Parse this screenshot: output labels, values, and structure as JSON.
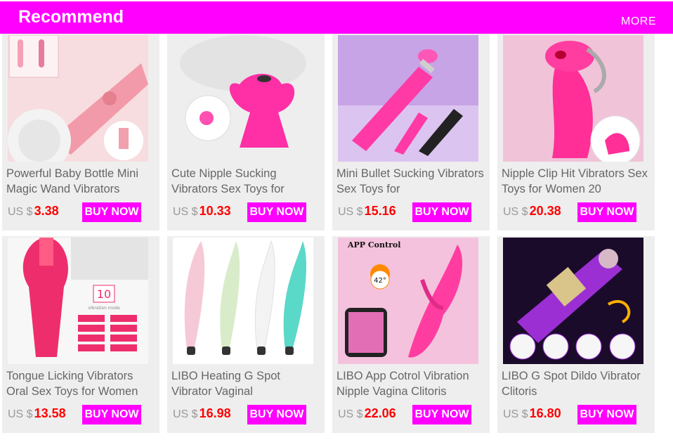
{
  "header": {
    "title": "Recommend",
    "more_label": "MORE"
  },
  "products": [
    {
      "name": "Powerful Baby Bottle Mini Magic Wand Vibrators",
      "currency": "US $",
      "price": "3.38",
      "buy_label": "BUY NOW",
      "image_icon": "wand-vibrator-image"
    },
    {
      "name": "Cute Nipple Sucking Vibrators Sex Toys for",
      "currency": "US $",
      "price": "10.33",
      "buy_label": "BUY NOW",
      "image_icon": "nipple-sucker-image"
    },
    {
      "name": "Mini Bullet Sucking Vibrators Sex Toys for",
      "currency": "US $",
      "price": "15.16",
      "buy_label": "BUY NOW",
      "image_icon": "bullet-vibrator-image"
    },
    {
      "name": "Nipple Clip Hit Vibrators Sex Toys for Women 20",
      "currency": "US $",
      "price": "20.38",
      "buy_label": "BUY NOW",
      "image_icon": "clip-vibrator-image"
    },
    {
      "name": "Tongue Licking Vibrators Oral Sex Toys for Women",
      "currency": "US $",
      "price": "13.58",
      "buy_label": "BUY NOW",
      "image_icon": "tongue-vibrator-image",
      "image_text": [
        "10",
        "vibration mode"
      ]
    },
    {
      "name": "LIBO Heating G Spot Vibrator Vaginal",
      "currency": "US $",
      "price": "16.98",
      "buy_label": "BUY NOW",
      "image_icon": "g-spot-vibrators-image"
    },
    {
      "name": "LIBO App Cotrol Vibration Nipple Vagina Clitoris",
      "currency": "US $",
      "price": "22.06",
      "buy_label": "BUY NOW",
      "image_icon": "app-control-vibrator-image",
      "image_text": [
        "APP Control",
        "42°"
      ]
    },
    {
      "name": "LIBO G Spot Dildo Vibrator Clitoris",
      "currency": "US $",
      "price": "16.80",
      "buy_label": "BUY NOW",
      "image_icon": "thrusting-dildo-image"
    }
  ],
  "colors": {
    "accent": "#ff00ff",
    "price": "#ff0000",
    "card_bg": "#eeeeee"
  }
}
